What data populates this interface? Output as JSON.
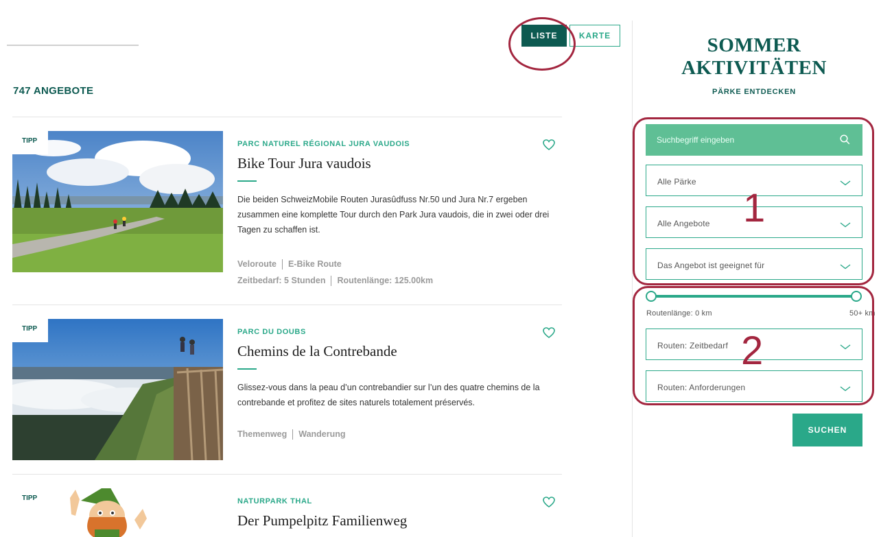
{
  "view_toggle": {
    "list_label": "LISTE",
    "map_label": "KARTE",
    "active": "LISTE"
  },
  "results": {
    "count_label": "747 ANGEBOTE"
  },
  "cards": [
    {
      "badge": "TIPP",
      "park": "PARC NATUREL RÉGIONAL JURA VAUDOIS",
      "title": "Bike Tour Jura vaudois",
      "description": "Die beiden SchweizMobile Routen Jurasûdfuss Nr.50 und Jura Nr.7 ergeben zusammen eine komplette Tour durch den Park Jura vaudois, die in zwei oder drei Tagen zu schaffen ist.",
      "tags_row1": [
        "Veloroute",
        "E-Bike Route"
      ],
      "tags_row2": [
        "Zeitbedarf: 5 Stunden",
        "Routenlänge: 125.00km"
      ],
      "image_icon": "landscape-photo-bikers"
    },
    {
      "badge": "TIPP",
      "park": "PARC DU DOUBS",
      "title": "Chemins de la Contrebande",
      "description": "Glissez-vous dans la peau d’un contrebandier sur l’un des quatre chemins de la contrebande et profitez de sites naturels totalement préservés.",
      "tags_row1": [
        "Themenweg",
        "Wanderung"
      ],
      "image_icon": "landscape-photo-fog-valley"
    },
    {
      "badge": "TIPP",
      "park": "NATURPARK THAL",
      "title": "Der Pumpelpitz Familienweg",
      "image_icon": "cartoon-gnome"
    }
  ],
  "sidebar": {
    "title_line1": "SOMMER",
    "title_line2": "AKTIVITÄTEN",
    "subtitle": "PÄRKE ENTDECKEN",
    "search_placeholder": "Suchbegriff eingeben",
    "filters_group1": [
      "Alle Pärke",
      "Alle Angebote",
      "Das Angebot ist geeignet für"
    ],
    "range_min_label": "Routenlänge: 0 km",
    "range_max_label": "50+ km",
    "range_min_value": 0,
    "range_max_value": 50,
    "filters_group2": [
      "Routen: Zeitbedarf",
      "Routen: Anforderungen"
    ],
    "submit_label": "SUCHEN"
  },
  "annotations": {
    "label_1": "1",
    "label_2": "2"
  },
  "colors": {
    "dark_green": "#0d5a51",
    "accent_green": "#2aa889",
    "search_bg": "#5fbf95",
    "annotation_red": "#a3263f"
  }
}
